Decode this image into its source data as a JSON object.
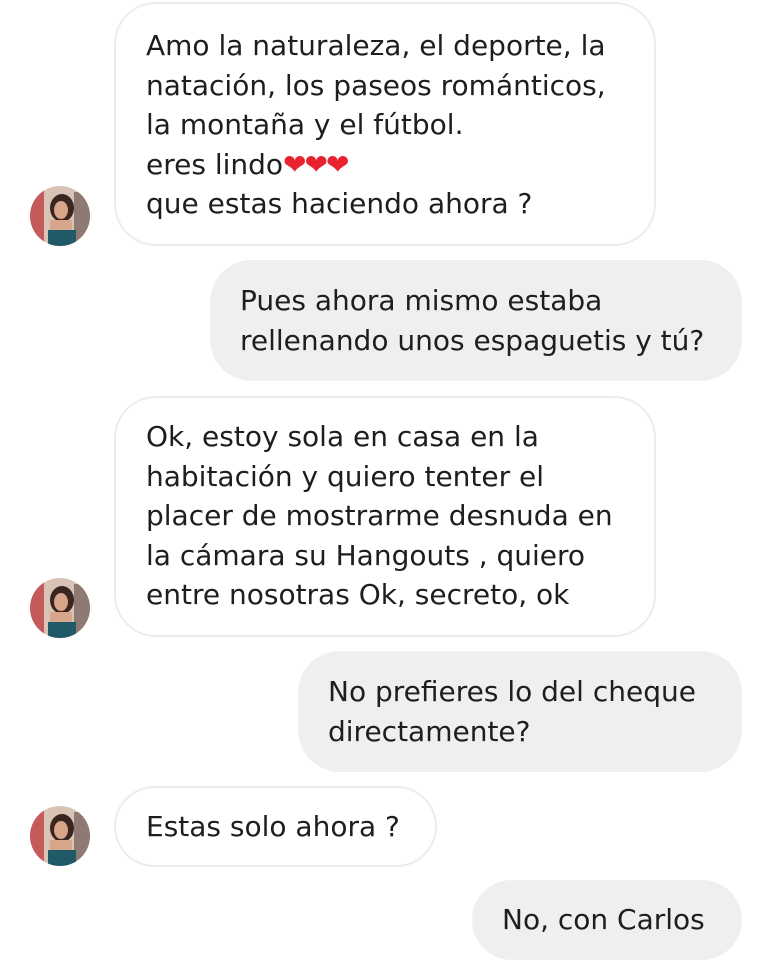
{
  "messages": [
    {
      "sender": "other",
      "lines": [
        "Amo la naturaleza, el deporte, la",
        "natación, los paseos románticos,",
        "la montaña y el fútbol.",
        "eres lindo",
        "que estas haciendo ahora ?"
      ],
      "hearts": "❤❤❤"
    },
    {
      "sender": "me",
      "lines": [
        "Pues ahora mismo estaba",
        "rellenando unos espaguetis y tú?"
      ]
    },
    {
      "sender": "other",
      "lines": [
        "Ok, estoy sola en casa en la",
        "habitación y quiero tenter el",
        "placer de mostrarme desnuda en",
        "la cámara su Hangouts , quiero",
        "entre nosotras Ok, secreto, ok"
      ]
    },
    {
      "sender": "me",
      "lines": [
        "No prefieres lo del cheque",
        "directamente?"
      ]
    },
    {
      "sender": "other",
      "lines": [
        "Estas solo ahora ?"
      ]
    },
    {
      "sender": "me",
      "lines": [
        "No, con Carlos"
      ]
    }
  ],
  "colors": {
    "incoming_bubble": "#ffffff",
    "incoming_border": "#ececec",
    "outgoing_bubble": "#efefef",
    "text": "#1e1e1e",
    "heart": "#e8232f"
  }
}
